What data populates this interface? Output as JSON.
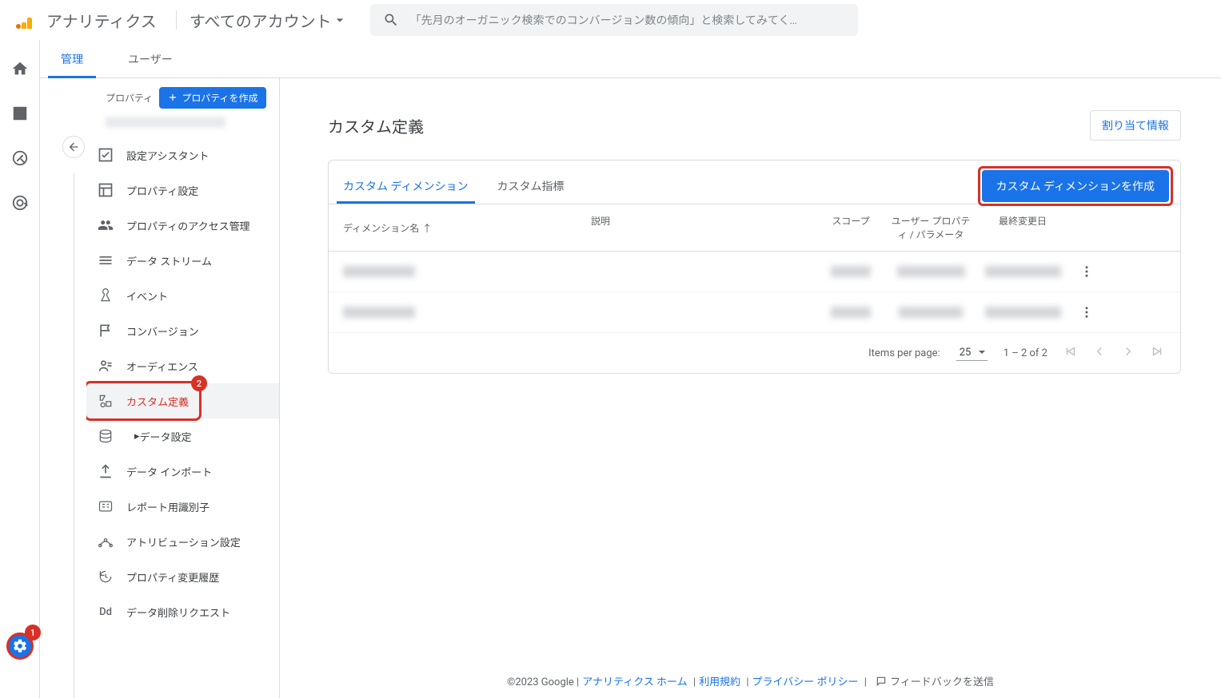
{
  "header": {
    "product": "アナリティクス",
    "account": "すべてのアカウント",
    "search_placeholder": "「先月のオーガニック検索でのコンバージョン数の傾向」と検索してみてく…"
  },
  "tabs": {
    "admin": "管理",
    "user": "ユーザー"
  },
  "sidebar": {
    "property_label": "プロパティ",
    "create_property": "プロパティを作成",
    "items": [
      {
        "label": "設定アシスタント"
      },
      {
        "label": "プロパティ設定"
      },
      {
        "label": "プロパティのアクセス管理"
      },
      {
        "label": "データ ストリーム"
      },
      {
        "label": "イベント"
      },
      {
        "label": "コンバージョン"
      },
      {
        "label": "オーディエンス"
      },
      {
        "label": "カスタム定義"
      },
      {
        "label": "データ設定"
      },
      {
        "label": "データ インポート"
      },
      {
        "label": "レポート用識別子"
      },
      {
        "label": "アトリビューション設定"
      },
      {
        "label": "プロパティ変更履歴"
      },
      {
        "label": "データ削除リクエスト"
      }
    ]
  },
  "page": {
    "title": "カスタム定義",
    "alloc_button": "割り当て情報",
    "content_tabs": {
      "dim": "カスタム ディメンション",
      "metric": "カスタム指標"
    },
    "create_dim": "カスタム ディメンションを作成",
    "columns": {
      "name": "ディメンション名",
      "arrow": "↑",
      "desc": "説明",
      "scope": "スコープ",
      "param": "ユーザー プロパティ / パラメータ",
      "date": "最終変更日"
    },
    "pager": {
      "label": "Items per page:",
      "value": "25",
      "range": "1 – 2 of 2"
    }
  },
  "annotations": {
    "badge1": "1",
    "badge2": "2"
  },
  "footer": {
    "copyright": "©2023 Google",
    "home": "アナリティクス ホーム",
    "terms": "利用規約",
    "privacy": "プライバシー ポリシー",
    "feedback": "フィードバックを送信"
  }
}
